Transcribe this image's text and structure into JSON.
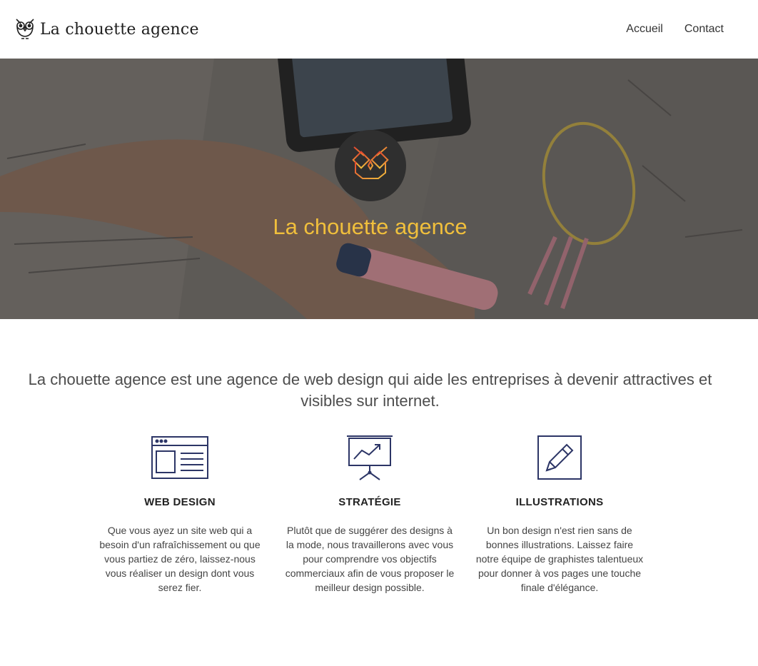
{
  "header": {
    "brand_name": "La chouette agence",
    "nav": [
      "Accueil",
      "Contact"
    ]
  },
  "hero": {
    "title": "La chouette agence"
  },
  "intro": "La chouette agence est une agence de web design qui aide les entreprises à devenir attractives et visibles sur internet.",
  "services": [
    {
      "icon": "web-design-icon",
      "title": "WEB DESIGN",
      "text": "Que vous ayez un site web qui a besoin d'un rafraîchissement ou que vous partiez de zéro, laissez-nous vous réaliser un design dont vous serez fier."
    },
    {
      "icon": "strategy-presentation-icon",
      "title": "STRATÉGIE",
      "text": "Plutôt que de suggérer des designs à la mode, nous travaillerons avec vous pour comprendre vos objectifs commerciaux afin de vous proposer le meilleur design possible."
    },
    {
      "icon": "pencil-icon",
      "title": "ILLUSTRATIONS",
      "text": "Un bon design n'est rien sans de bonnes illustrations. Laissez faire notre équipe de graphistes talentueux pour donner à vos pages une touche finale d'élégance."
    }
  ],
  "colors": {
    "accent": "#f0bf3c",
    "icon_stroke": "#2c3566",
    "badge_bg": "#2f2f2f"
  }
}
